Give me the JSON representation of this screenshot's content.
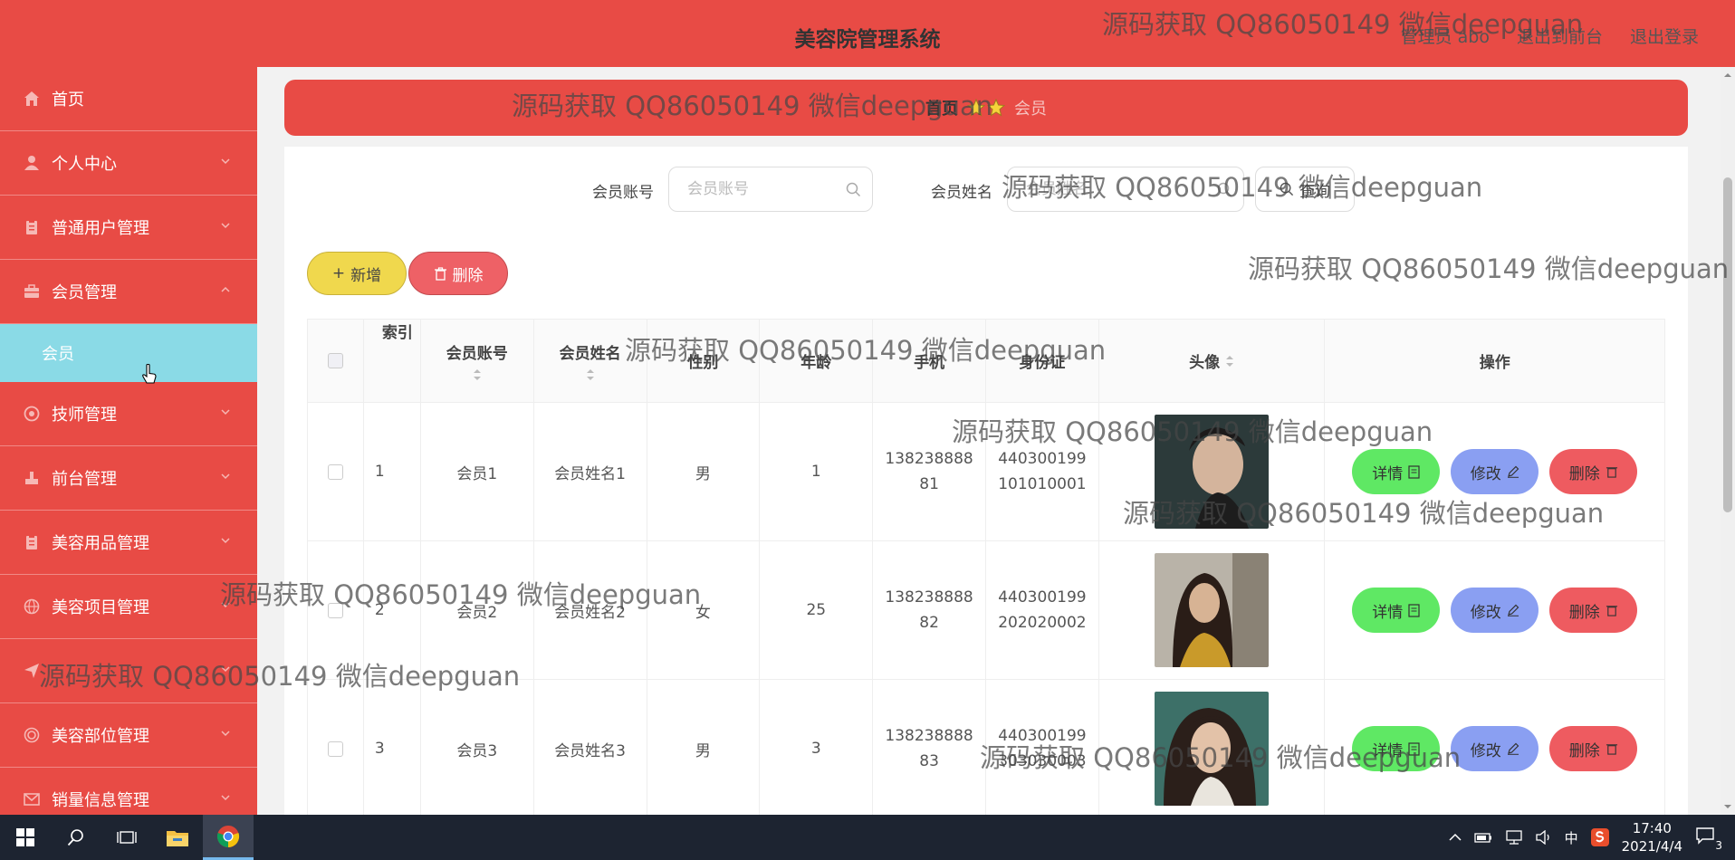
{
  "header": {
    "title": "美容院管理系统",
    "links": [
      "管理员 abo",
      "退出到前台",
      "退出登录"
    ]
  },
  "sidebar": {
    "items": [
      {
        "label": "首页",
        "icon": "home-icon"
      },
      {
        "label": "个人中心",
        "icon": "user-icon"
      },
      {
        "label": "普通用户管理",
        "icon": "clipboard-icon"
      },
      {
        "label": "会员管理",
        "icon": "briefcase-icon",
        "expanded": true,
        "sub": [
          "会员"
        ]
      },
      {
        "label": "技师管理",
        "icon": "settings-icon"
      },
      {
        "label": "前台管理",
        "icon": "stamp-icon"
      },
      {
        "label": "美容用品管理",
        "icon": "clipboard-icon"
      },
      {
        "label": "美容项目管理",
        "icon": "globe-icon"
      },
      {
        "label": "美容部位管理",
        "icon": "target-icon"
      },
      {
        "label": "销量信息管理",
        "icon": "mail-icon"
      }
    ]
  },
  "breadcrumb": {
    "home": "首页",
    "current": "会员"
  },
  "search": {
    "account_label": "会员账号",
    "account_placeholder": "会员账号",
    "name_label": "会员姓名",
    "name_placeholder": "会员姓名",
    "query_label": "查询"
  },
  "actions": {
    "add_label": "新增",
    "delete_label": "删除"
  },
  "table": {
    "headers": {
      "index": "索引",
      "account": "会员账号",
      "name": "会员姓名",
      "sex": "性别",
      "age": "年龄",
      "phone": "手机",
      "id_card": "身份证",
      "avatar": "头像",
      "ops": "操作"
    },
    "rows": [
      {
        "index": "1",
        "account": "会员1",
        "name": "会员姓名1",
        "sex": "男",
        "age": "1",
        "phone1": "138238888",
        "phone2": "81",
        "id1": "440300199",
        "id2": "101010001"
      },
      {
        "index": "2",
        "account": "会员2",
        "name": "会员姓名2",
        "sex": "女",
        "age": "25",
        "phone1": "138238888",
        "phone2": "82",
        "id1": "440300199",
        "id2": "202020002"
      },
      {
        "index": "3",
        "account": "会员3",
        "name": "会员姓名3",
        "sex": "男",
        "age": "3",
        "phone1": "138238888",
        "phone2": "83",
        "id1": "440300199",
        "id2": "303030003"
      }
    ],
    "op_labels": {
      "detail": "详情",
      "edit": "修改",
      "delete": "删除"
    }
  },
  "watermark": "源码获取 QQ86050149 微信deepguan",
  "taskbar": {
    "time": "17:40",
    "date": "2021/4/4",
    "ime": "中",
    "notifications": "3"
  },
  "colors": {
    "primary": "#e84b45",
    "submenu_active": "#8adae6",
    "detail": "#5fe864",
    "edit": "#8a9ff2",
    "delete": "#ee5b60",
    "add": "#f0d84d"
  }
}
